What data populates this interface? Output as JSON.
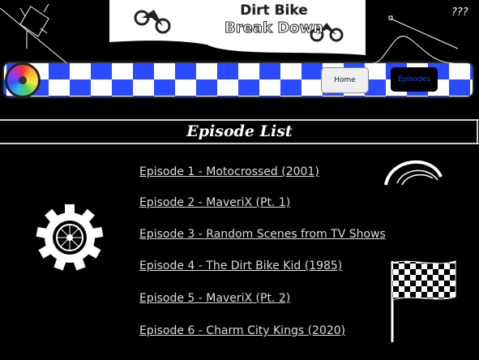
{
  "logo": {
    "line1": "Dirt Bike",
    "line2": "Break Down"
  },
  "doodle": {
    "question_marks": "???"
  },
  "nav": {
    "home_label": "Home",
    "episodes_label": "Episodes",
    "active": "Episodes",
    "accent": "#2a4bff"
  },
  "page_title": "Episode List",
  "episodes": [
    "Episode 1 - Motocrossed (2001)",
    "Episode 2 - MaveriX (Pt. 1)",
    "Episode 3 - Random Scenes from TV Shows",
    "Episode 4 - The Dirt Bike Kid (1985)",
    "Episode 5 - MaveriX (Pt. 2)",
    "Episode 6 - Charm City Kings (2020)"
  ]
}
